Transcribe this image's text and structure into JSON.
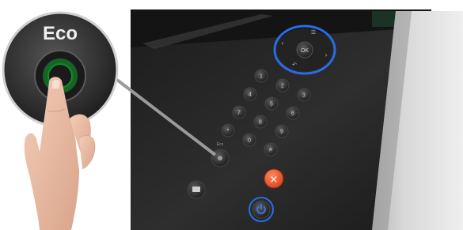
{
  "eco_inset": {
    "label": "Eco"
  },
  "panel": {
    "ok_label": "OK",
    "keypad_rows": [
      [
        "1",
        "2",
        "3"
      ],
      [
        "4",
        "5",
        "6"
      ],
      [
        "7",
        "8",
        "9"
      ],
      [
        "*",
        "0",
        "#"
      ]
    ],
    "eco_button_label": "Eco",
    "stop_symbol": "×"
  },
  "colors": {
    "eco_glow": "#35e05a",
    "nav_ring": "#2a6be8",
    "power_ring": "#2a6be8",
    "stop_button": "#e8502a",
    "panel_dark": "#2b2b2b"
  },
  "icons": {
    "nav_up": "menu-icon",
    "nav_back": "back-arrow-icon",
    "power": "power-icon",
    "print_screen": "print-screen-icon",
    "stop": "stop-icon",
    "eco": "eco-leaf-icon"
  }
}
